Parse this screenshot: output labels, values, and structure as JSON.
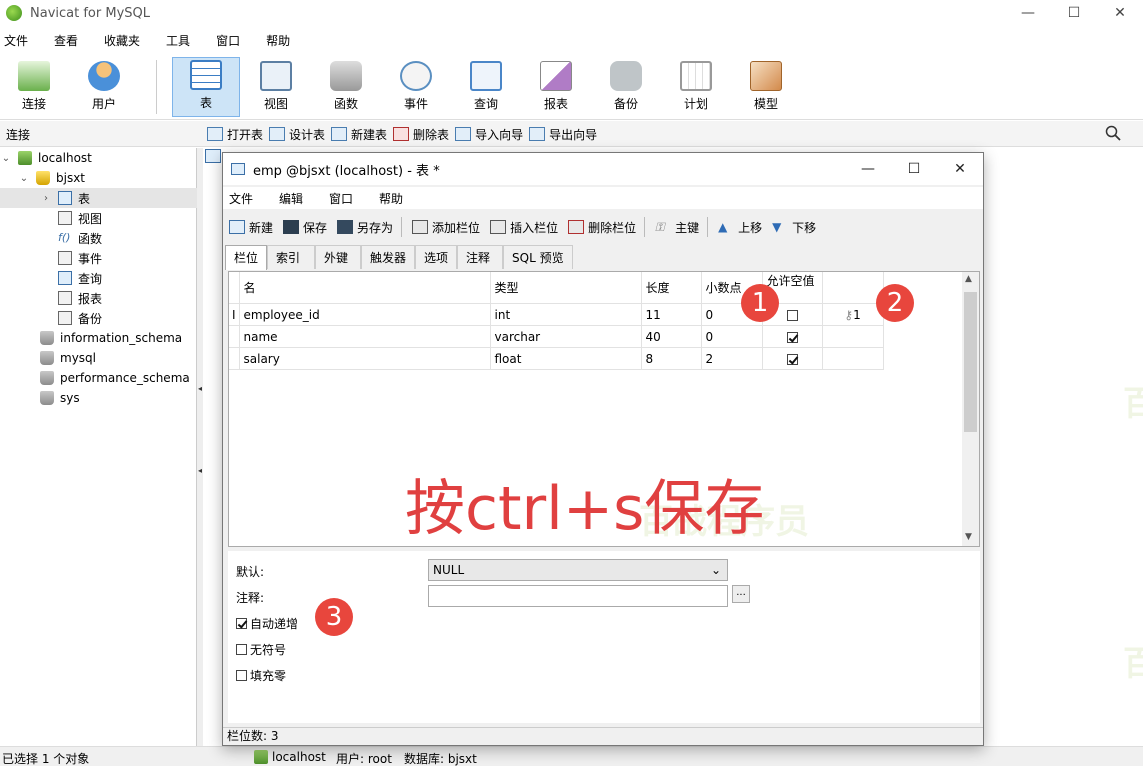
{
  "app": {
    "title": "Navicat for MySQL",
    "min": "—",
    "max": "☐",
    "close": "✕"
  },
  "menubar": [
    "文件",
    "查看",
    "收藏夹",
    "工具",
    "窗口",
    "帮助"
  ],
  "ribbon": [
    {
      "label": "连接",
      "icon": "plug-icon",
      "color": "#6ab04c"
    },
    {
      "label": "用户",
      "icon": "user-icon",
      "color": "#e8a03c"
    },
    {
      "label": "表",
      "icon": "table-icon",
      "color": "#3b7dc4",
      "active": true
    },
    {
      "label": "视图",
      "icon": "view-icon",
      "color": "#5c7fa3"
    },
    {
      "label": "函数",
      "icon": "function-icon",
      "color": "#e68a2e"
    },
    {
      "label": "事件",
      "icon": "event-icon",
      "color": "#5a8fc1"
    },
    {
      "label": "查询",
      "icon": "query-icon",
      "color": "#4a86c8"
    },
    {
      "label": "报表",
      "icon": "report-icon",
      "color": "#9b59b6"
    },
    {
      "label": "备份",
      "icon": "backup-icon",
      "color": "#7f8c8d"
    },
    {
      "label": "计划",
      "icon": "schedule-icon",
      "color": "#c0392b"
    },
    {
      "label": "模型",
      "icon": "model-icon",
      "color": "#d35400"
    }
  ],
  "subbar": {
    "connection_label": "连接",
    "tools": [
      "打开表",
      "设计表",
      "新建表",
      "删除表",
      "导入向导",
      "导出向导"
    ]
  },
  "tree": {
    "server": "localhost",
    "open_db": "bjsxt",
    "children": [
      "表",
      "视图",
      "函数",
      "事件",
      "查询",
      "报表",
      "备份"
    ],
    "other_dbs": [
      "information_schema",
      "mysql",
      "performance_schema",
      "sys"
    ]
  },
  "status": {
    "selection": "已选择 1 个对象",
    "server": "localhost",
    "user": "用户: root",
    "database": "数据库: bjsxt"
  },
  "child": {
    "title": "emp @bjsxt (localhost) - 表 *",
    "menu": [
      "文件",
      "编辑",
      "窗口",
      "帮助"
    ],
    "tools": [
      "新建",
      "保存",
      "另存为",
      "添加栏位",
      "插入栏位",
      "删除栏位",
      "主键",
      "上移",
      "下移"
    ],
    "tabs": [
      "栏位",
      "索引",
      "外键",
      "触发器",
      "选项",
      "注释",
      "SQL 预览"
    ],
    "columns": [
      "名",
      "类型",
      "长度",
      "小数点",
      "允许空值 (",
      ""
    ],
    "rows": [
      {
        "name": "employee_id",
        "type": "int",
        "length": "11",
        "decimals": "0",
        "nullable": false,
        "key": "1",
        "current": true
      },
      {
        "name": "name",
        "type": "varchar",
        "length": "40",
        "decimals": "0",
        "nullable": true,
        "key": "",
        "current": false
      },
      {
        "name": "salary",
        "type": "float",
        "length": "8",
        "decimals": "2",
        "nullable": true,
        "key": "",
        "current": false
      }
    ],
    "props": {
      "default_label": "默认:",
      "default_value": "NULL",
      "comment_label": "注释:",
      "ellipsis": "...",
      "auto_increment": "自动递增",
      "unsigned": "无符号",
      "zerofill": "填充零"
    },
    "status": "栏位数: 3"
  },
  "annotations": {
    "badge1": "1",
    "badge2": "2",
    "badge3": "3",
    "instruction": "按ctrl+s保存"
  },
  "watermark": "百战程序员"
}
